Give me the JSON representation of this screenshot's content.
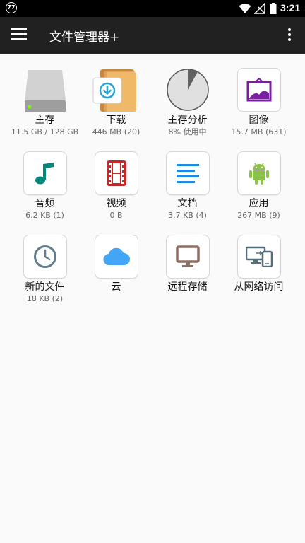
{
  "status_bar": {
    "notification_badge": "77",
    "time": "3:21"
  },
  "app_bar": {
    "title": "文件管理器+"
  },
  "tiles": [
    {
      "label": "主存",
      "sub": "11.5 GB / 128 GB"
    },
    {
      "label": "下载",
      "sub": "446 MB (20)"
    },
    {
      "label": "主存分析",
      "sub": "8% 使用中"
    },
    {
      "label": "图像",
      "sub": "15.7 MB (631)"
    },
    {
      "label": "音频",
      "sub": "6.2 KB (1)"
    },
    {
      "label": "视频",
      "sub": "0 B"
    },
    {
      "label": "文档",
      "sub": "3.7 KB (4)"
    },
    {
      "label": "应用",
      "sub": "267 MB (9)"
    },
    {
      "label": "新的文件",
      "sub": "18 KB (2)"
    },
    {
      "label": "云",
      "sub": ""
    },
    {
      "label": "远程存储",
      "sub": ""
    },
    {
      "label": "从网络访问",
      "sub": ""
    }
  ],
  "storage_analysis": {
    "used_fraction": 0.08
  },
  "colors": {
    "app_bar": "#212121",
    "background": "#fafafa",
    "images": "#7b1fa2",
    "audio": "#00897b",
    "video": "#c62828",
    "documents": "#1e88e5",
    "apps": "#8bc34a",
    "recent": "#607d8b",
    "cloud": "#42a5f5",
    "remote": "#8d6e63",
    "lan": "#546e7a"
  }
}
